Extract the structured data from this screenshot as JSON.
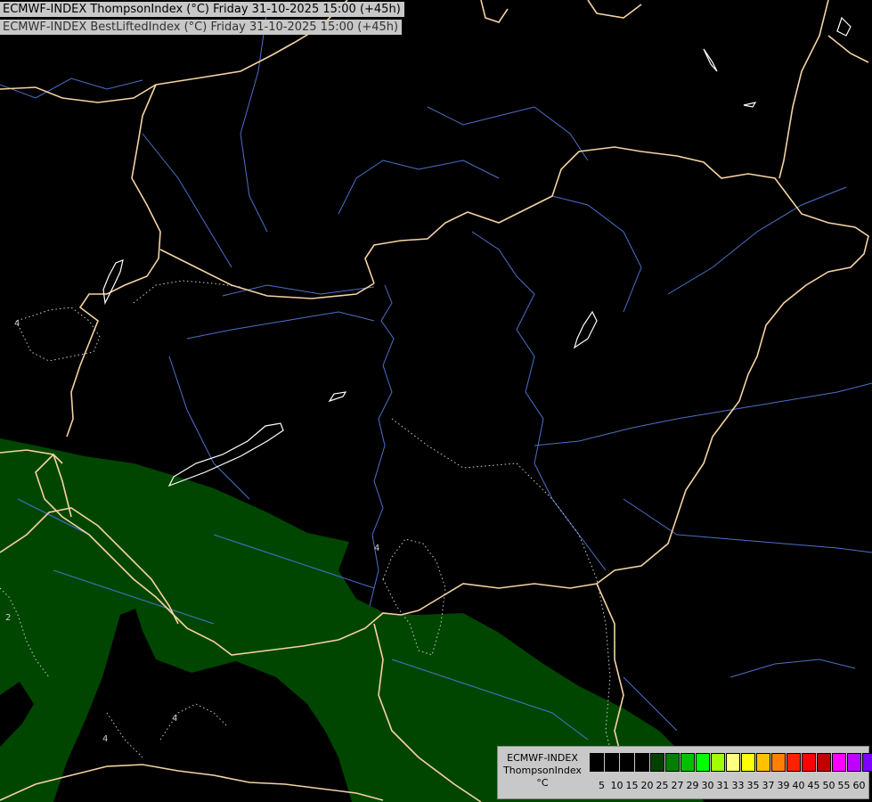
{
  "header": {
    "line1": "ECMWF-INDEX ThompsonIndex (°C) Friday 31-10-2025 15:00 (+45h)",
    "line2": "ECMWF-INDEX BestLiftedIndex (°C) Friday 31-10-2025 15:00 (+45h)"
  },
  "legend": {
    "model": "ECMWF-INDEX",
    "param": "ThompsonIndex",
    "unit": "°C",
    "colors": [
      "#000000",
      "#000000",
      "#000000",
      "#000000",
      "#004000",
      "#008000",
      "#00c000",
      "#00ff00",
      "#a0ff00",
      "#ffff80",
      "#ffff00",
      "#ffc000",
      "#ff8000",
      "#ff2000",
      "#ff0000",
      "#c00000",
      "#ff00ff",
      "#c000ff",
      "#8000ff",
      "#4040ff",
      "#0000ff"
    ],
    "ticks": [
      "5",
      "10",
      "15",
      "20",
      "25",
      "27",
      "29",
      "30",
      "31",
      "33",
      "35",
      "37",
      "39",
      "40",
      "45",
      "50",
      "55",
      "60"
    ]
  },
  "contour_labels": [
    "4",
    "2",
    "4",
    "4",
    "4"
  ],
  "colors": {
    "background": "#000000",
    "green_field": "#004600",
    "border": "#f5d3a3",
    "river": "#4d70c8",
    "lake": "#ffffff",
    "contour": "#cccccc"
  }
}
